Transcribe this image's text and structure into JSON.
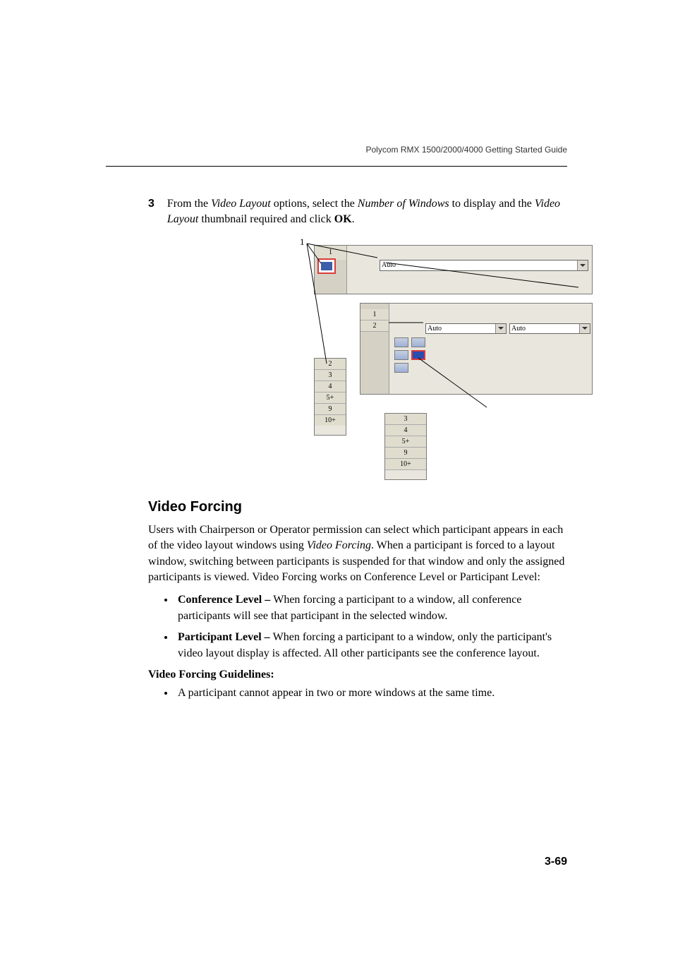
{
  "header": {
    "running": "Polycom RMX 1500/2000/4000 Getting Started Guide"
  },
  "step": {
    "number": "3",
    "pre": "From the ",
    "i1": "Video Layout",
    "mid1": " options, select the ",
    "i2": "Number of Windows",
    "mid2": " to display and the ",
    "i3": "Video Layout",
    "mid3": " thumbnail required and click ",
    "bold": "OK",
    "post": "."
  },
  "screenshot": {
    "callout1": "1",
    "back_sidebar": [
      "1",
      "2",
      "3",
      "4",
      "5+",
      "9",
      "10+"
    ],
    "dd_label": "Auto",
    "mid_sidebar": [
      "1",
      "2"
    ],
    "mid_dd1": "Auto",
    "mid_dd2": "Auto",
    "front_cells": [
      "3",
      "4",
      "5+",
      "9",
      "10+"
    ]
  },
  "section": {
    "heading": "Video Forcing",
    "para1_pre": "Users with Chairperson or Operator permission can select which participant appears in each of the video layout windows using ",
    "para1_i": "Video Forcing",
    "para1_post": ". When a participant is forced to a layout window, switching between participants is suspended for that window and only the assigned participants is viewed. Video Forcing works on Conference Level or Participant Level:",
    "bullet1_runin": "Conference Level – ",
    "bullet1_text": "When forcing a participant to a window, all conference participants will see that participant in the selected window.",
    "bullet2_runin": "Participant Level – ",
    "bullet2_text": "When forcing a participant to a window, only the participant's video layout display is affected. All other participants see the conference layout.",
    "subhead": "Video Forcing Guidelines:",
    "bullet3": "A participant cannot appear in two or more windows at the same time."
  },
  "footer": {
    "page": "3-69"
  }
}
